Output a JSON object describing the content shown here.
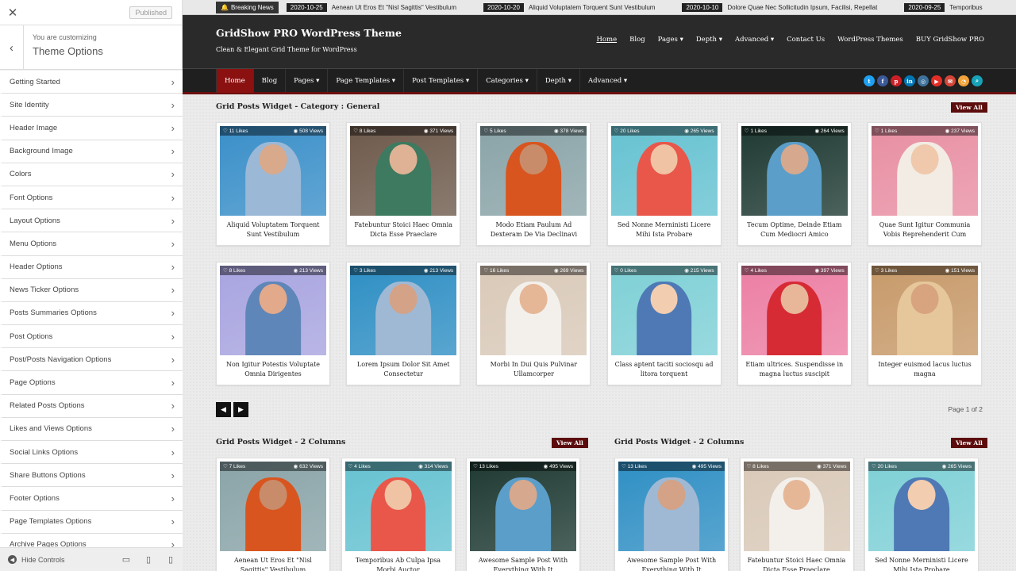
{
  "sidebar": {
    "status": "Published",
    "customizing": "You are customizing",
    "title": "Theme Options",
    "items": [
      "Getting Started",
      "Site Identity",
      "Header Image",
      "Background Image",
      "Colors",
      "Font Options",
      "Layout Options",
      "Menu Options",
      "Header Options",
      "News Ticker Options",
      "Posts Summaries Options",
      "Post Options",
      "Post/Posts Navigation Options",
      "Page Options",
      "Related Posts Options",
      "Likes and Views Options",
      "Social Links Options",
      "Share Buttons Options",
      "Footer Options",
      "Page Templates Options",
      "Archive Pages Options"
    ],
    "hide_controls": "Hide Controls"
  },
  "ticker": {
    "label": "Breaking News",
    "items": [
      {
        "date": "2020-10-25",
        "title": "Aenean Ut Eros Et \"Nisl Sagittis\" Vestibulum"
      },
      {
        "date": "2020-10-20",
        "title": "Aliquid Voluptatem Torquent Sunt Vestibulum"
      },
      {
        "date": "2020-10-10",
        "title": "Dolore Quae Nec Sollicitudin Ipsum, Facilisi, Repellat"
      },
      {
        "date": "2020-09-25",
        "title": "Temporibus"
      }
    ]
  },
  "header": {
    "site_title": "GridShow PRO WordPress Theme",
    "tagline": "Clean & Elegant Grid Theme for WordPress",
    "top_nav": [
      "Home",
      "Blog",
      "Pages ▾",
      "Depth ▾",
      "Advanced ▾",
      "Contact Us",
      "WordPress Themes",
      "BUY GridShow PRO"
    ]
  },
  "main_nav": [
    "Home",
    "Blog",
    "Pages ▾",
    "Page Templates ▾",
    "Post Templates ▾",
    "Categories ▾",
    "Depth ▾",
    "Advanced ▾"
  ],
  "social": [
    {
      "icon": "twitter-icon",
      "glyph": "t",
      "color": "#1da1f2"
    },
    {
      "icon": "facebook-icon",
      "glyph": "f",
      "color": "#3b5998"
    },
    {
      "icon": "pinterest-icon",
      "glyph": "p",
      "color": "#cb2027"
    },
    {
      "icon": "linkedin-icon",
      "glyph": "in",
      "color": "#0077b5"
    },
    {
      "icon": "instagram-icon",
      "glyph": "◎",
      "color": "#3f729b"
    },
    {
      "icon": "youtube-icon",
      "glyph": "▶",
      "color": "#e52d27"
    },
    {
      "icon": "email-icon",
      "glyph": "✉",
      "color": "#d44638"
    },
    {
      "icon": "rss-icon",
      "glyph": "◔",
      "color": "#f2a33a"
    },
    {
      "icon": "search-icon",
      "glyph": "⌕",
      "color": "#17a2b8"
    }
  ],
  "section1": {
    "title": "Grid Posts Widget - Category : General",
    "view_all": "View All",
    "posts": [
      {
        "likes": "11 Likes",
        "views": "508 Views",
        "title": "Aliquid Voluptatem Torquent Sunt Vestibulum"
      },
      {
        "likes": "8 Likes",
        "views": "371 Views",
        "title": "Fatebuntur Stoici Haec Omnia Dicta Esse Praeclare"
      },
      {
        "likes": "5 Likes",
        "views": "378 Views",
        "title": "Modo Etiam Paulum Ad Dexteram De Via Declinavi"
      },
      {
        "likes": "20 Likes",
        "views": "265 Views",
        "title": "Sed Nonne Merninisti Licere Mihi Ista Probare"
      },
      {
        "likes": "1 Likes",
        "views": "264 Views",
        "title": "Tecum Optime, Deinde Etiam Cum Mediocri Amico"
      },
      {
        "likes": "1 Likes",
        "views": "237 Views",
        "title": "Quae Sunt Igitur Communia Vobis Reprehenderit Cum"
      },
      {
        "likes": "8 Likes",
        "views": "213 Views",
        "title": "Non Igitur Potestis Voluptate Omnia Dirigentes"
      },
      {
        "likes": "3 Likes",
        "views": "213 Views",
        "title": "Lorem Ipsum Dolor Sit Amet Consectetur"
      },
      {
        "likes": "16 Likes",
        "views": "269 Views",
        "title": "Morbi In Dui Quis Pulvinar Ullamcorper"
      },
      {
        "likes": "0 Likes",
        "views": "215 Views",
        "title": "Class aptent taciti sociosqu ad litora torquent"
      },
      {
        "likes": "4 Likes",
        "views": "397 Views",
        "title": "Etiam ultrices. Suspendisse in magna luctus suscipit"
      },
      {
        "likes": "3 Likes",
        "views": "151 Views",
        "title": "Integer euismod lacus luctus magna"
      }
    ],
    "page_of": "Page 1 of 2"
  },
  "section2": {
    "title": "Grid Posts Widget - 2 Columns",
    "view_all": "View All",
    "posts": [
      {
        "likes": "7 Likes",
        "views": "632 Views",
        "title": "Aenean Ut Eros Et \"Nisl Sagittis\" Vestibulum"
      },
      {
        "likes": "4 Likes",
        "views": "314 Views",
        "title": "Temporibus Ab Culpa Ipsa Morbi Auctor"
      },
      {
        "likes": "13 Likes",
        "views": "495 Views",
        "title": "Awesome Sample Post With Everything With It"
      }
    ]
  },
  "section3": {
    "title": "Grid Posts Widget - 2 Columns",
    "view_all": "View All",
    "posts": [
      {
        "likes": "13 Likes",
        "views": "495 Views",
        "title": "Awesome Sample Post With Everything With It"
      },
      {
        "likes": "8 Likes",
        "views": "371 Views",
        "title": "Fatebuntur Stoici Haec Omnia Dicta Esse Praeclare"
      },
      {
        "likes": "20 Likes",
        "views": "265 Views",
        "title": "Sed Nonne Merninisti Licere Mihi Ista Probare"
      }
    ]
  },
  "photo_colors": [
    {
      "bg": "#3a8fc9",
      "fig": "#9bb8d6",
      "skin": "#d9a98b"
    },
    {
      "bg": "#6e5a4c",
      "fig": "#3d7a5f",
      "skin": "#e0b295"
    },
    {
      "bg": "#8aa4a8",
      "fig": "#d8551f",
      "skin": "#c98c6a"
    },
    {
      "bg": "#66c2d1",
      "fig": "#e8574a",
      "skin": "#f0c3a5"
    },
    {
      "bg": "#1f3a33",
      "fig": "#5b9ec9",
      "skin": "#d6a88e"
    },
    {
      "bg": "#e88fa3",
      "fig": "#f2ece4",
      "skin": "#f0c8ab"
    },
    {
      "bg": "#a8a4e0",
      "fig": "#5f86b8",
      "skin": "#e2a98a"
    },
    {
      "bg": "#2f8fc4",
      "fig": "#9fb9d4",
      "skin": "#d4a287"
    },
    {
      "bg": "#d9c9b8",
      "fig": "#f3f0ec",
      "skin": "#e5b797"
    },
    {
      "bg": "#7ed0d6",
      "fig": "#4e79b5",
      "skin": "#f2cdb0"
    },
    {
      "bg": "#ec7fa4",
      "fig": "#d62b35",
      "skin": "#e8b699"
    },
    {
      "bg": "#c79a6a",
      "fig": "#e6c79b",
      "skin": "#d8a47f"
    }
  ]
}
